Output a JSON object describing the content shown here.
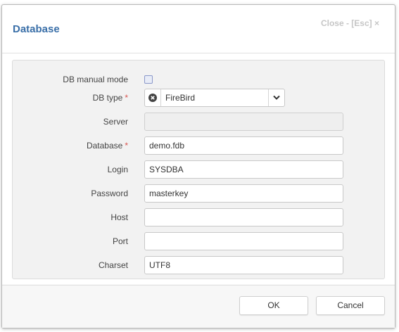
{
  "dialog": {
    "title": "Database",
    "close_label": "Close - [Esc] ×"
  },
  "form": {
    "db_manual_mode": {
      "label": "DB manual mode",
      "checked": false
    },
    "db_type": {
      "label": "DB type",
      "required_mark": "*",
      "value": "FireBird"
    },
    "server": {
      "label": "Server",
      "value": "",
      "disabled": true
    },
    "database": {
      "label": "Database",
      "required_mark": "*",
      "value": "demo.fdb"
    },
    "login": {
      "label": "Login",
      "value": "SYSDBA"
    },
    "password": {
      "label": "Password",
      "value": "masterkey"
    },
    "host": {
      "label": "Host",
      "value": ""
    },
    "port": {
      "label": "Port",
      "value": ""
    },
    "charset": {
      "label": "Charset",
      "value": "UTF8"
    }
  },
  "footer": {
    "ok_label": "OK",
    "cancel_label": "Cancel"
  },
  "colors": {
    "title": "#3a6fa8",
    "required": "#d9534f",
    "close_link": "#c6c6c6"
  },
  "icons": {
    "clear": "clear-icon",
    "dropdown": "chevron-down-icon"
  }
}
